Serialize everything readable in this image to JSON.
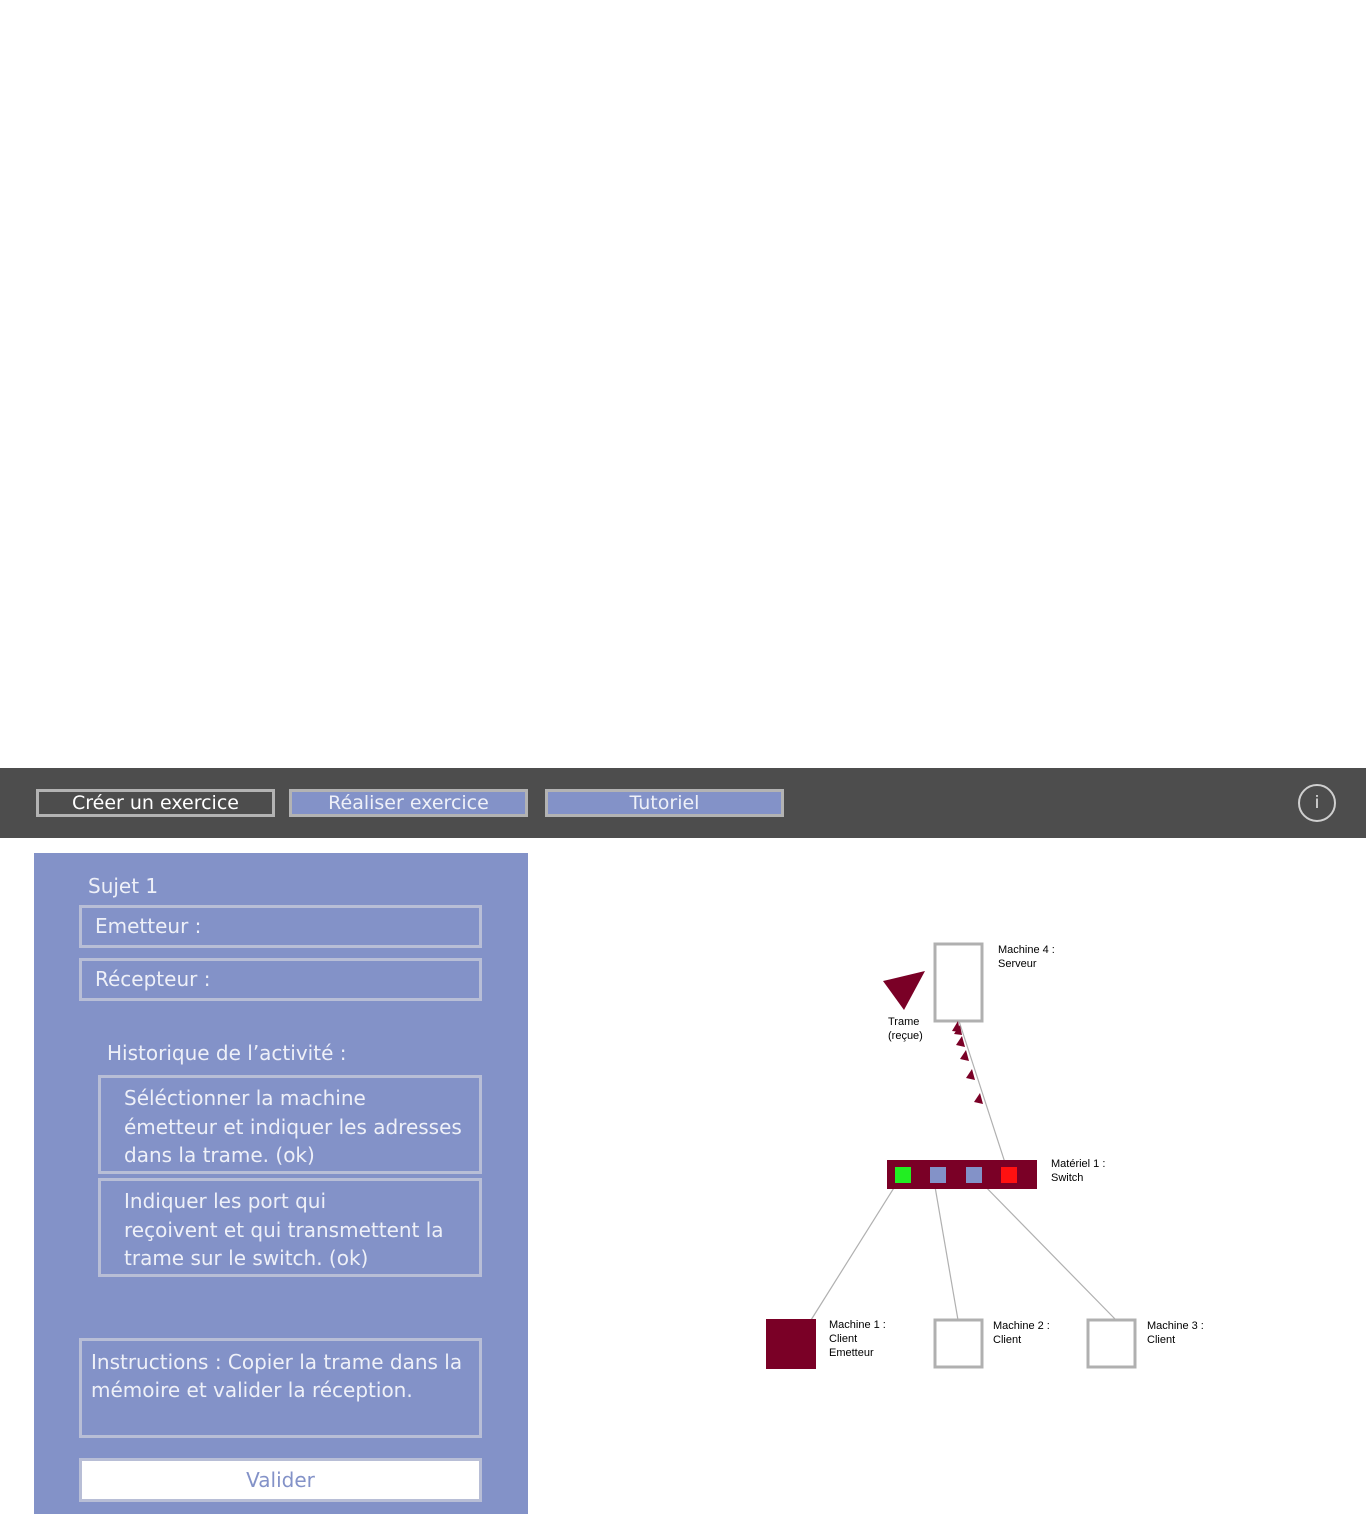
{
  "nav": {
    "create_label": "Créer un exercice",
    "do_label": "Réaliser exercice",
    "tutorial_label": "Tutoriel",
    "info_label": "i"
  },
  "panel": {
    "subject": "Sujet 1",
    "emitter_label": "Emetteur :",
    "receiver_label": "Récepteur :",
    "history_title": "Historique de l’activité :",
    "history": [
      [
        "Séléctionner la machine",
        "émetteur et indiquer les adresses",
        "dans la trame. (ok)"
      ],
      [
        "Indiquer les port qui",
        "reçoivent et qui transmettent la",
        "trame sur le switch. (ok)"
      ]
    ],
    "instructions": [
      "Instructions : Copier la trame dans la",
      "mémoire et valider la réception."
    ],
    "validate_label": "Valider"
  },
  "diagram": {
    "machine4": [
      "Machine 4 :",
      "Serveur"
    ],
    "frame": [
      "Trame",
      "(reçue)"
    ],
    "switch": [
      "Matériel 1 :",
      "Switch"
    ],
    "machine1": [
      "Machine 1 :",
      "Client",
      "Emetteur"
    ],
    "machine2": [
      "Machine 2 :",
      "Client"
    ],
    "machine3": [
      "Machine 3 :",
      "Client"
    ],
    "colors": {
      "accent": "#7a0026",
      "port_active_in": "#22ee22",
      "port_active_out": "#ff1111",
      "port_idle": "#8392c8",
      "panel": "#8392c8",
      "toolbar": "#4d4d4d"
    }
  }
}
